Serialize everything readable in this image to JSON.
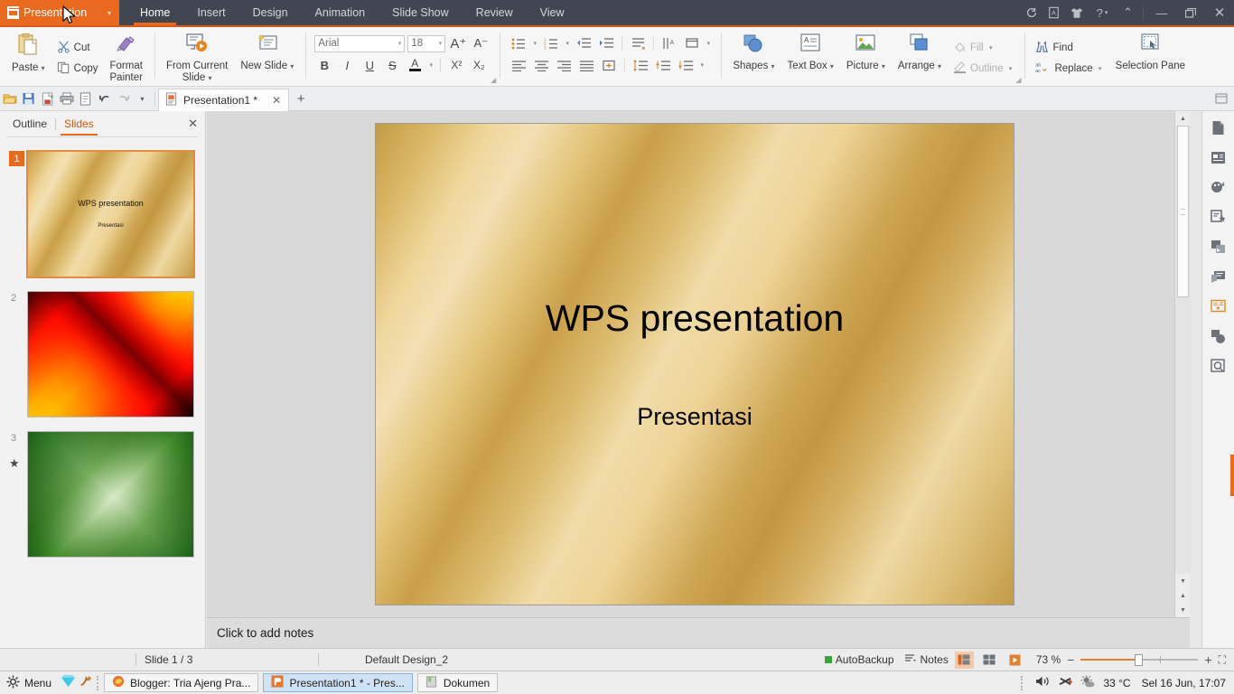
{
  "titlebar": {
    "app_name": "Presentation",
    "app_caret": "▾",
    "tabs": [
      {
        "label": "Home",
        "active": true
      },
      {
        "label": "Insert",
        "active": false
      },
      {
        "label": "Design",
        "active": false
      },
      {
        "label": "Animation",
        "active": false
      },
      {
        "label": "Slide Show",
        "active": false
      },
      {
        "label": "Review",
        "active": false
      },
      {
        "label": "View",
        "active": false
      }
    ],
    "right_icons": [
      "sync-icon",
      "document-badge-icon",
      "shirt-icon",
      "help-icon",
      "collapse-ribbon-icon"
    ],
    "help_label": "?",
    "help_caret": "▾",
    "collapse": "⌃",
    "minimize": "—",
    "restore": "❐",
    "close": "✕"
  },
  "ribbon": {
    "paste": {
      "label": "Paste",
      "caret": "▾"
    },
    "cut": "Cut",
    "copy": "Copy",
    "format_painter": "Format\nPainter",
    "from_current_slide": {
      "label": "From Current\nSlide",
      "caret": "▾"
    },
    "new_slide": {
      "label": "New Slide",
      "caret": "▾"
    },
    "font_name": "Arial",
    "font_size": "18",
    "grow_font": "A⁺",
    "shrink_font": "A⁻",
    "bold": "B",
    "italic": "I",
    "underline": "U",
    "strikethrough": "S",
    "font_color": "A",
    "superscript": "X²",
    "subscript": "X₂",
    "shapes": {
      "label": "Shapes",
      "caret": "▾"
    },
    "text_box": {
      "label": "Text Box",
      "caret": "▾"
    },
    "picture": {
      "label": "Picture",
      "caret": "▾"
    },
    "arrange": {
      "label": "Arrange",
      "caret": "▾"
    },
    "fill": {
      "label": "Fill",
      "caret": "▾",
      "disabled": true
    },
    "outline": {
      "label": "Outline",
      "caret": "▾",
      "disabled": true
    },
    "find": "Find",
    "replace": {
      "label": "Replace",
      "caret": "▾"
    },
    "selection_pane": "Selection Pane"
  },
  "quick_access": {
    "icons": [
      "open-icon",
      "save-icon",
      "export-pdf-icon",
      "print-icon",
      "print-preview-icon",
      "undo-icon",
      "redo-icon",
      "customize-caret-icon"
    ],
    "caret": "▾",
    "document_tab": "Presentation1 *",
    "tab_close": "✕",
    "new_tab": "+"
  },
  "left_pane": {
    "tab_outline": "Outline",
    "tab_slides": "Slides",
    "close": "✕",
    "slides": [
      {
        "number": "1",
        "selected": true,
        "theme": "goldbg",
        "title": "WPS presentation",
        "subtitle": "Presentasi",
        "animated": false
      },
      {
        "number": "2",
        "selected": false,
        "theme": "redbg",
        "title": "",
        "subtitle": "",
        "animated": false
      },
      {
        "number": "3",
        "selected": false,
        "theme": "greenbg",
        "title": "",
        "subtitle": "",
        "animated": true,
        "anim_icon": "★"
      }
    ]
  },
  "slide": {
    "title": "WPS presentation",
    "subtitle": "Presentasi"
  },
  "notes": {
    "placeholder": "Click to add notes"
  },
  "right_rail": {
    "icons": [
      "new-document-icon",
      "slide-layout-icon",
      "design-ideas-icon",
      "animation-pane-icon",
      "transition-icon",
      "comment-icon",
      "template-icon",
      "shape-format-icon",
      "picture-search-icon"
    ]
  },
  "statusbar": {
    "slide_counter": "Slide 1 / 3",
    "design_name": "Default Design_2",
    "autobackup": "AutoBackup",
    "notes_button": "Notes",
    "view_normal": "normal-view-icon",
    "view_sorter": "slide-sorter-icon",
    "view_show": "slideshow-icon",
    "zoom_value": "73 %",
    "zoom_out": "−",
    "zoom_in": "+",
    "fit_window": "⛶"
  },
  "taskbar": {
    "menu_label": "Menu",
    "tray_icons": [
      "gem-icon",
      "bug-icon"
    ],
    "tasks": [
      {
        "label": "Blogger: Tria Ajeng Pra...",
        "icon": "firefox-icon",
        "active": false
      },
      {
        "label": "Presentation1 * - Pres...",
        "icon": "wps-presentation-icon",
        "active": true
      },
      {
        "label": "Dokumen",
        "icon": "folder-icon",
        "active": false
      }
    ],
    "volume": "volume-icon",
    "bluetooth": "bluetooth-icon",
    "weather_icon": "sun-cloud-icon",
    "temperature": "33 °C",
    "datetime": "Sel 16 Jun, 17:07"
  },
  "colors": {
    "accent": "#e96a1e",
    "titlebar": "#414750",
    "ribbon": "#f6f6f6"
  }
}
